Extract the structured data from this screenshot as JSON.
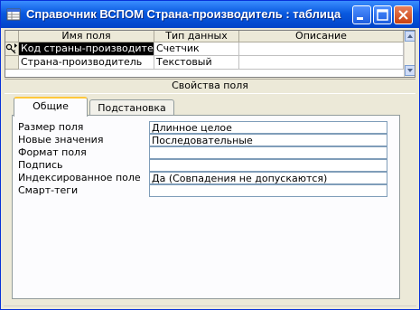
{
  "window": {
    "title": "Справочник ВСПОМ Страна-производитель : таблица"
  },
  "grid": {
    "columns": [
      "Имя поля",
      "Тип данных",
      "Описание"
    ],
    "rows": [
      {
        "name": "Код страны-производителя",
        "type": "Счетчик",
        "description": "",
        "is_key": true,
        "selected": true
      },
      {
        "name": "Страна-производитель",
        "type": "Текстовый",
        "description": "",
        "is_key": false,
        "selected": false
      }
    ]
  },
  "properties": {
    "header": "Свойства поля",
    "tabs": [
      {
        "label": "Общие",
        "active": true
      },
      {
        "label": "Подстановка",
        "active": false
      }
    ],
    "items": [
      {
        "label": "Размер поля",
        "value": "Длинное целое"
      },
      {
        "label": "Новые значения",
        "value": "Последовательные"
      },
      {
        "label": "Формат поля",
        "value": ""
      },
      {
        "label": "Подпись",
        "value": ""
      },
      {
        "label": "Индексированное поле",
        "value": "Да (Совпадения не допускаются)"
      },
      {
        "label": "Смарт-теги",
        "value": ""
      }
    ]
  },
  "icons": {
    "app": "table-design-icon",
    "minimize": "minimize-icon",
    "maximize": "maximize-icon",
    "close": "close-icon",
    "primary_key": "key-icon",
    "scroll_up": "arrow-up-icon",
    "scroll_down": "arrow-down-icon"
  },
  "colors": {
    "titlebar": "#0a5ae0",
    "close_button": "#c9400f",
    "active_tab_accent": "#ffc83c",
    "selection": "#000000"
  }
}
